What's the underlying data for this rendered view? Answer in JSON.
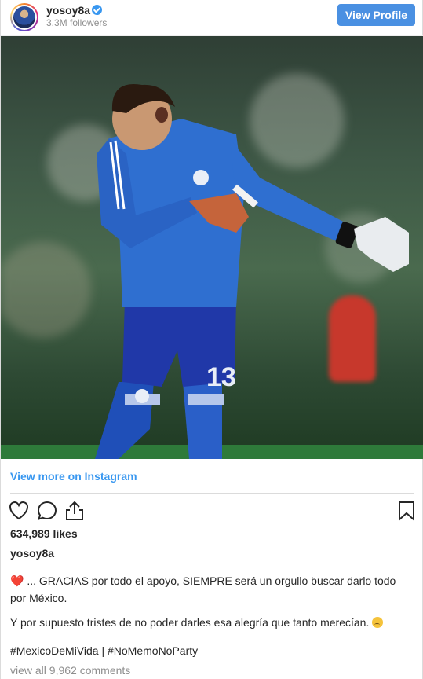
{
  "header": {
    "username": "yosoy8a",
    "followers": "3.3M followers",
    "view_profile_label": "View Profile"
  },
  "photo": {
    "jersey_number": "13"
  },
  "links": {
    "view_more": "View more on Instagram"
  },
  "stats": {
    "likes": "634,989 likes"
  },
  "caption": {
    "username": "yosoy8a",
    "line1_emoji": "❤️",
    "line1": "... GRACIAS por todo el apoyo, SIEMPRE será un orgullo buscar darlo todo por México.",
    "line2": "Y por supuesto tristes de no poder darles esa alegría que tanto merecían.",
    "hashtags": "#MexicoDeMiVida | #NoMemoNoParty",
    "comments": "view all 9,962 comments"
  },
  "colors": {
    "accent": "#4a90e2",
    "link": "#3897f0",
    "verified": "#3897f0",
    "jersey": "#2f6fd0"
  },
  "icons": {
    "like": "heart-icon",
    "comment": "comment-icon",
    "share": "share-icon",
    "save": "bookmark-icon"
  }
}
